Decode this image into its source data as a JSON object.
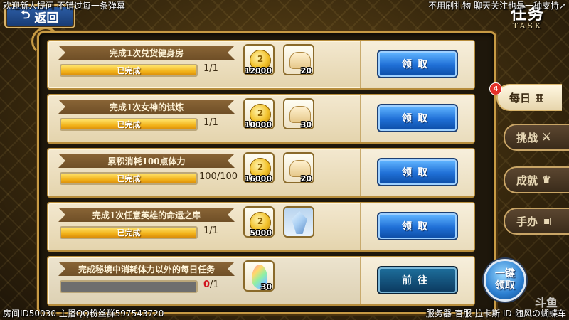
{
  "overlay": {
    "top_left": "欢迎新人提问 不错过每一条弹幕",
    "top_right": "不用刷礼物 聊天关注也是一种支持↗",
    "bottom_left": "房间ID50030 主播QQ粉丝群597543720",
    "bottom_right": "服务器-官服 拉卡斯 ID-随风の蝴蝶车",
    "watermark": "斗鱼"
  },
  "header": {
    "back_label": "返回",
    "title_cn": "任务",
    "title_en": "TASK"
  },
  "tabs": [
    {
      "label": "每日",
      "badge": "4",
      "active": true
    },
    {
      "label": "挑战",
      "active": false
    },
    {
      "label": "成就",
      "active": false
    },
    {
      "label": "手办",
      "active": false
    }
  ],
  "tasks": [
    {
      "title": "完成1次兑货健身房",
      "progress_label": "已完成",
      "progress_fraction": 1.0,
      "count": "1/1",
      "rewards": [
        {
          "icon": "gold-coin",
          "qty": "12000"
        },
        {
          "icon": "bread",
          "qty": "20"
        }
      ],
      "action": "领取"
    },
    {
      "title": "完成1次女神的试炼",
      "progress_label": "已完成",
      "progress_fraction": 1.0,
      "count": "1/1",
      "rewards": [
        {
          "icon": "gold-coin",
          "qty": "10000"
        },
        {
          "icon": "bread",
          "qty": "30"
        }
      ],
      "action": "领取"
    },
    {
      "title": "累积消耗100点体力",
      "progress_label": "已完成",
      "progress_fraction": 1.0,
      "count": "100/100",
      "rewards": [
        {
          "icon": "gold-coin",
          "qty": "16000"
        },
        {
          "icon": "bread",
          "qty": "20"
        }
      ],
      "action": "领取"
    },
    {
      "title": "完成1次任意英雄的命运之扉",
      "progress_label": "已完成",
      "progress_fraction": 1.0,
      "count": "1/1",
      "rewards": [
        {
          "icon": "gold-coin",
          "qty": "5000"
        },
        {
          "icon": "crystal",
          "qty": ""
        }
      ],
      "action": "领取"
    },
    {
      "title": "完成秘境中消耗体力以外的每日任务",
      "progress_label": "",
      "progress_fraction": 0.0,
      "count_done": "0",
      "count_total": "/1",
      "rewards": [
        {
          "icon": "rainbow-gem",
          "qty": "30"
        }
      ],
      "action": "前往"
    }
  ],
  "one_click": {
    "line1": "一键",
    "line2": "领取"
  },
  "colors": {
    "claim_button": "#1f6fd6",
    "goto_button": "#0c3b61",
    "progress_fill": "#f2b21a",
    "frame_gold": "#c79a44"
  }
}
